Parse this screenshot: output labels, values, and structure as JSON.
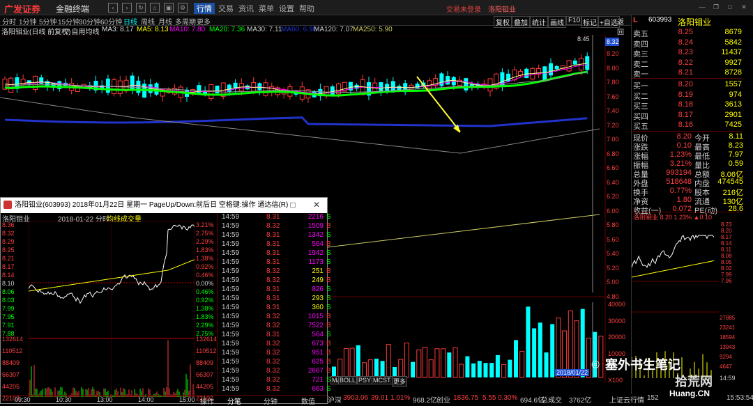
{
  "titlebar": {
    "logo": "广发证券",
    "app": "金融终端",
    "menus": [
      "行情",
      "交易",
      "资讯",
      "菜单",
      "设置",
      "帮助"
    ],
    "trade_status": "交易未登录",
    "stock": "洛阳钼业"
  },
  "toolbar": {
    "periods": [
      "分时",
      "1分钟",
      "5分钟",
      "15分钟",
      "30分钟",
      "60分钟",
      "日线",
      "周线",
      "月线",
      "多周期",
      "更多"
    ],
    "right": [
      "复权",
      "叠加",
      "统计",
      "画线",
      "F10",
      "标记",
      "+自选",
      "返回"
    ]
  },
  "info": {
    "name": "洛阳钼业(日线 前复权)",
    "indicator": "▽ 自用均线",
    "ma3": "MA3: 8.17",
    "ma5": "MA5: 8.13",
    "ma10": "MA10: 7.80",
    "ma20": "MA20: 7.36",
    "ma30": "MA30: 7.11",
    "ma60": "MA60: 6.90",
    "ma120": "MA120: 7.07",
    "ma250": "MA250: 5.90"
  },
  "main_axis": {
    "labels": [
      "8.32",
      "8.20",
      "8.00",
      "7.80",
      "7.60",
      "7.40",
      "7.20",
      "7.00",
      "6.80",
      "6.60",
      "6.40",
      "6.20",
      "6.00",
      "5.80",
      "5.60",
      "5.40",
      "5.20",
      "5.00",
      "4.80"
    ],
    "high_mark": "8.45"
  },
  "vol_axis": {
    "labels": [
      "40000",
      "30000",
      "20000",
      "10000"
    ],
    "unit": "X100"
  },
  "indicators": [
    "MACD",
    "BOLL",
    "PSY",
    "MCST",
    "更多"
  ],
  "quote": {
    "header_code": "603993",
    "header_name": "洛阳钼业",
    "header_l": "L",
    "asks": [
      {
        "lab": "卖五",
        "p": "8.25",
        "v": "8679"
      },
      {
        "lab": "卖四",
        "p": "8.24",
        "v": "5842"
      },
      {
        "lab": "卖三",
        "p": "8.23",
        "v": "11437"
      },
      {
        "lab": "卖二",
        "p": "8.22",
        "v": "9927"
      },
      {
        "lab": "卖一",
        "p": "8.21",
        "v": "8728"
      }
    ],
    "bids": [
      {
        "lab": "买一",
        "p": "8.20",
        "v": "1557"
      },
      {
        "lab": "买二",
        "p": "8.19",
        "v": "974"
      },
      {
        "lab": "买三",
        "p": "8.18",
        "v": "3613"
      },
      {
        "lab": "买四",
        "p": "8.17",
        "v": "2901"
      },
      {
        "lab": "买五",
        "p": "8.16",
        "v": "7425"
      }
    ],
    "stats": [
      {
        "l1": "现价",
        "v1": "8.20",
        "l2": "今开",
        "v2": "8.11"
      },
      {
        "l1": "涨跌",
        "v1": "0.10",
        "l2": "最高",
        "v2": "8.23"
      },
      {
        "l1": "涨幅",
        "v1": "1.23%",
        "l2": "最低",
        "v2": "7.97"
      },
      {
        "l1": "振幅",
        "v1": "3.21%",
        "l2": "量比",
        "v2": "0.59"
      },
      {
        "l1": "总量",
        "v1": "993194",
        "l2": "总额",
        "v2": "8.06亿"
      },
      {
        "l1": "外盘",
        "v1": "518648",
        "l2": "内盘",
        "v2": "474545"
      },
      {
        "l1": "换手",
        "v1": "0.77%",
        "l2": "股本",
        "v2": "216亿"
      },
      {
        "l1": "净资",
        "v1": "1.80",
        "l2": "流通",
        "v2": "130亿"
      },
      {
        "l1": "收益(一)",
        "v1": "0.072",
        "l2": "PE(动)",
        "v2": "28.6"
      }
    ],
    "mini_header": "洛阳钼业 8.20 1.23% ▲0.10",
    "mini_prices": [
      "8.23",
      "8.20",
      "8.17",
      "8.14",
      "8.11",
      "8.08",
      "8.05",
      "8.02",
      "7.99",
      "7.96"
    ],
    "mini_vols": [
      "27885",
      "23241",
      "18594",
      "13943",
      "9294",
      "4647"
    ],
    "mini_time": "14:59"
  },
  "popup": {
    "title": "洛阳钼业(603993) 2018年01月22日 星期一 PageUp/Down:前后日 空格键:操作 通达信(R)",
    "header_left": "洛阳钼业",
    "header_date": "2018-01-22 分时",
    "header_avg": "均线",
    "header_vol": "成交量",
    "price_labels": [
      "8.36",
      "8.32",
      "8.29",
      "8.25",
      "8.21",
      "8.17",
      "8.14",
      "8.10",
      "8.06",
      "8.03",
      "7.99",
      "7.95",
      "7.91",
      "7.88"
    ],
    "pct_labels": [
      "3.21%",
      "2.75%",
      "2.29%",
      "1.83%",
      "1.38%",
      "0.92%",
      "0.46%",
      "0.00%",
      "0.46%",
      "0.92%",
      "1.38%",
      "1.83%",
      "2.29%",
      "2.75%"
    ],
    "vol_labels": [
      "132614",
      "110512",
      "88409",
      "66307",
      "44205",
      "22102"
    ],
    "times": [
      "09:30",
      "10:30",
      "13:00",
      "14:00",
      "15:00"
    ],
    "ticks": [
      {
        "t": "14:59",
        "p": "8.31",
        "v": "2216",
        "d": "S"
      },
      {
        "t": "14:59",
        "p": "8.32",
        "v": "1509",
        "d": "B"
      },
      {
        "t": "14:59",
        "p": "8.31",
        "v": "1342",
        "d": "S"
      },
      {
        "t": "14:59",
        "p": "8.31",
        "v": "564",
        "d": "B"
      },
      {
        "t": "14:59",
        "p": "8.31",
        "v": "1942",
        "d": "S"
      },
      {
        "t": "14:59",
        "p": "8.31",
        "v": "1173",
        "d": "S"
      },
      {
        "t": "14:59",
        "p": "8.32",
        "v": "251",
        "d": "B"
      },
      {
        "t": "14:59",
        "p": "8.32",
        "v": "249",
        "d": "B"
      },
      {
        "t": "14:59",
        "p": "8.31",
        "v": "826",
        "d": "S"
      },
      {
        "t": "14:59",
        "p": "8.31",
        "v": "293",
        "d": "S"
      },
      {
        "t": "14:59",
        "p": "8.31",
        "v": "360",
        "d": "S"
      },
      {
        "t": "14:59",
        "p": "8.32",
        "v": "1015",
        "d": "B"
      },
      {
        "t": "14:59",
        "p": "8.32",
        "v": "7522",
        "d": "B"
      },
      {
        "t": "14:59",
        "p": "8.31",
        "v": "564",
        "d": "S"
      },
      {
        "t": "14:59",
        "p": "8.32",
        "v": "673",
        "d": "B"
      },
      {
        "t": "14:59",
        "p": "8.32",
        "v": "951",
        "d": "B"
      },
      {
        "t": "14:59",
        "p": "8.32",
        "v": "625",
        "d": "B"
      },
      {
        "t": "14:59",
        "p": "8.32",
        "v": "2667",
        "d": "B"
      },
      {
        "t": "14:59",
        "p": "8.32",
        "v": "721",
        "d": "S"
      },
      {
        "t": "14:59",
        "p": "8.32",
        "v": "663",
        "d": "S"
      }
    ],
    "tabs": [
      "操作",
      "分笔",
      "分钟",
      "数值"
    ]
  },
  "statusbar": {
    "sh": "沪深",
    "sh_v": "3903.06",
    "sh_c": "39.01",
    "sh_p": "1.01%",
    "sh_a": "968.2亿",
    "cy": "创业",
    "cy_v": "1836.75",
    "cy_c": "5.55",
    "cy_p": "0.30%",
    "cy_a": "694.6亿",
    "deal": "总成交",
    "deal_v": "3762亿",
    "server": "上证云行情",
    "server_id": "152",
    "clock": "15:53:54"
  },
  "date_label": "2018/01/22",
  "watermark": {
    "w1": "塞外书生笔记",
    "w2": "拾荒网",
    "url": "Huang.CN"
  },
  "colors": {
    "red": "#ff3b3b",
    "cyan": "#00ffff",
    "yellow": "#ffff00",
    "green": "#00ff00",
    "blue": "#2233cc",
    "magenta": "#ff00ff"
  }
}
